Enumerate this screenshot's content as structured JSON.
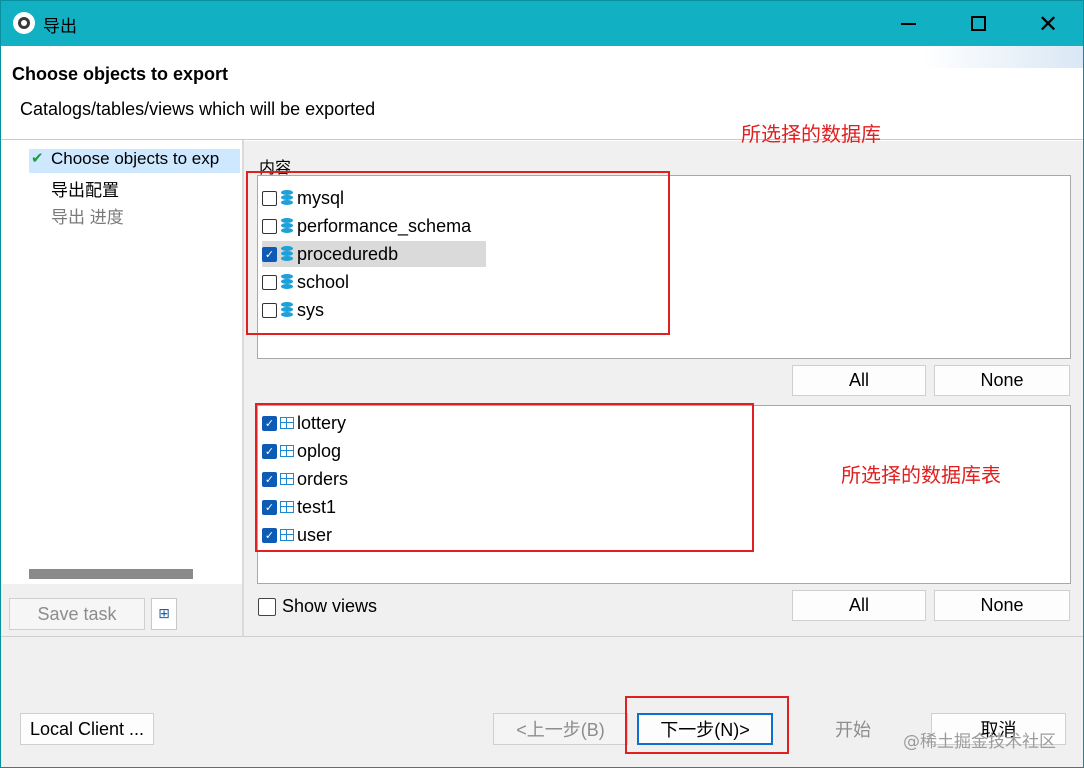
{
  "window": {
    "title": "导出",
    "minimize": "",
    "maximize": "",
    "close": "✕"
  },
  "header": {
    "title": "Choose objects to export",
    "description": "Catalogs/tables/views which will be exported"
  },
  "nav": {
    "items": [
      {
        "label": "Choose objects to exp",
        "selected": true,
        "done": true
      },
      {
        "label": "导出配置",
        "selected": false
      },
      {
        "label": "导出 进度",
        "selected": false
      }
    ],
    "save_task": "Save task"
  },
  "content": {
    "label": "内容",
    "catalogs": [
      {
        "name": "mysql",
        "checked": false
      },
      {
        "name": "performance_schema",
        "checked": false
      },
      {
        "name": "proceduredb",
        "checked": true
      },
      {
        "name": "school",
        "checked": false
      },
      {
        "name": "sys",
        "checked": false
      }
    ],
    "catalog_all": "All",
    "catalog_none": "None",
    "tables": [
      {
        "name": "lottery",
        "checked": true
      },
      {
        "name": "oplog",
        "checked": true
      },
      {
        "name": "orders",
        "checked": true
      },
      {
        "name": "test1",
        "checked": true
      },
      {
        "name": "user",
        "checked": true
      }
    ],
    "show_views": "Show views",
    "table_all": "All",
    "table_none": "None"
  },
  "footer": {
    "local_client": "Local Client ...",
    "back": "<上一步(B)",
    "next": "下一步(N)>",
    "start": "开始",
    "cancel": "取消"
  },
  "annotations": {
    "catalogs_note": "所选择的数据库",
    "tables_note": "所选择的数据库表"
  },
  "watermark": "@稀土掘金技术社区",
  "colors": {
    "titlebar": "#12b0c3",
    "annotation": "#e02020",
    "checkbox_checked": "#0d5bb5",
    "db_icon": "#1ea0d8"
  }
}
